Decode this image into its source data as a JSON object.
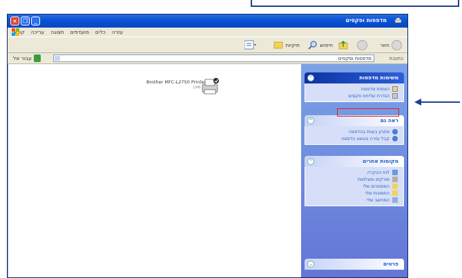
{
  "window": {
    "title": "מדפסות ופקסים",
    "buttons": {
      "close": "×",
      "restore": "❐",
      "minimize": "_"
    }
  },
  "menu": [
    "קובץ",
    "עריכה",
    "תצוגה",
    "מועדפים",
    "כלים",
    "עזרה"
  ],
  "toolbar": {
    "back": "חזור",
    "search": "חיפוש",
    "folders": "תיקיות"
  },
  "address": {
    "label": "כתובת",
    "value": "מדפסות ופקסים",
    "go": "עבור אל"
  },
  "printer": {
    "name": "Brother MFC-L2750 Printer",
    "status": "0",
    "substatus": "מוכן"
  },
  "taskpane": {
    "printer_tasks": {
      "title": "משימות מדפסות",
      "items": [
        "הוספת מדפסת",
        "הגדרת שליחת פקסים"
      ]
    },
    "see_also": {
      "title": "ראה גם",
      "items": [
        "פתרון בעיות בהדפסה",
        "קבל עזרה בנושא הדפסה"
      ]
    },
    "other_places": {
      "title": "מקומות אחרים",
      "items": [
        "לוח הבקרה",
        "סורקים ומצלמות",
        "המסמכים שלי",
        "התמונות שלי",
        "המחשב שלי"
      ]
    },
    "details": {
      "title": "פרטים"
    }
  },
  "colors": {
    "highlight": "#e02020",
    "annotation": "#1f3f8f",
    "titlebar": "#0a55d6"
  }
}
